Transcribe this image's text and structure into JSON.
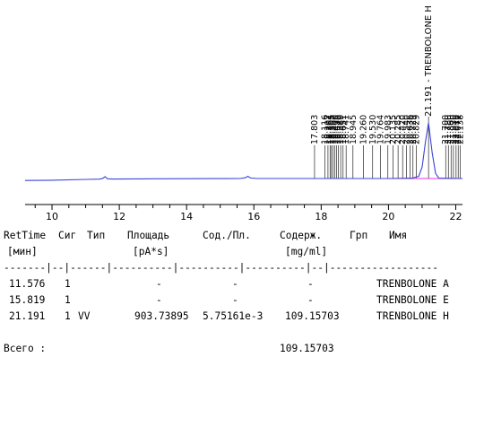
{
  "chart_data": {
    "type": "line",
    "xlabel": "",
    "ylabel": "",
    "xlim": [
      9.2,
      22.2
    ],
    "ylim": [
      0,
      100
    ],
    "x_ticks": [
      "10",
      "12",
      "14",
      "16",
      "18",
      "20",
      "22"
    ],
    "series": [
      {
        "x": [
          9.2,
          10.0,
          11.0,
          11.4,
          11.5,
          11.576,
          11.65,
          11.8,
          12.5,
          13.0,
          14.0,
          14.8,
          15.6,
          15.75,
          15.819,
          15.9,
          16.1,
          17.0,
          18.0,
          19.0,
          20.0,
          20.7,
          20.9,
          21.0,
          21.1,
          21.191,
          21.3,
          21.4,
          21.5,
          22.2
        ],
        "y": [
          0.5,
          0.8,
          1.6,
          1.9,
          2.5,
          4.5,
          2.3,
          2.0,
          2.2,
          2.3,
          2.4,
          2.5,
          2.6,
          3.5,
          5.0,
          3.2,
          2.6,
          2.6,
          2.6,
          2.6,
          2.6,
          3.0,
          5.0,
          15.0,
          42.0,
          62.0,
          30.0,
          8.0,
          3.0,
          2.6
        ],
        "color": "#3b44d8"
      }
    ],
    "baseline": {
      "x": [
        19.3,
        22.2
      ],
      "y": [
        2.6,
        2.6
      ],
      "color": "#e33ae0"
    },
    "peak_labels": [
      {
        "x": 17.803,
        "text": "17.803"
      },
      {
        "x": 18.116,
        "text": "18.116"
      },
      {
        "x": 18.202,
        "text": "18.202"
      },
      {
        "x": 18.264,
        "text": "18.264"
      },
      {
        "x": 18.305,
        "text": "18.305"
      },
      {
        "x": 18.352,
        "text": "18.352"
      },
      {
        "x": 18.4,
        "text": "18.400"
      },
      {
        "x": 18.455,
        "text": "18.455"
      },
      {
        "x": 18.51,
        "text": "18.510"
      },
      {
        "x": 18.58,
        "text": "18.580"
      },
      {
        "x": 18.651,
        "text": "18.651"
      },
      {
        "x": 18.741,
        "text": "18.741"
      },
      {
        "x": 18.945,
        "text": "18.945"
      },
      {
        "x": 19.26,
        "text": "19.260"
      },
      {
        "x": 19.53,
        "text": "19.530"
      },
      {
        "x": 19.764,
        "text": "19.764"
      },
      {
        "x": 19.983,
        "text": "19.983"
      },
      {
        "x": 20.135,
        "text": "20.135"
      },
      {
        "x": 20.285,
        "text": "20.285"
      },
      {
        "x": 20.42,
        "text": "20.420"
      },
      {
        "x": 20.54,
        "text": "20.540"
      },
      {
        "x": 20.636,
        "text": "20.636"
      },
      {
        "x": 20.729,
        "text": "20.729"
      },
      {
        "x": 20.829,
        "text": "20.829"
      },
      {
        "x": 21.191,
        "text": "21.191 - TRENBOLONE H"
      },
      {
        "x": 21.7,
        "text": "21.700"
      },
      {
        "x": 21.78,
        "text": "21.780"
      },
      {
        "x": 21.86,
        "text": "21.860"
      },
      {
        "x": 21.93,
        "text": "21.930"
      },
      {
        "x": 22.01,
        "text": "22.010"
      },
      {
        "x": 22.072,
        "text": "22.072"
      },
      {
        "x": 22.138,
        "text": "22.138"
      }
    ]
  },
  "report": {
    "header1": [
      "RetTime",
      "Сиг",
      "Тип",
      "Площадь",
      "Сод./Пл.",
      "Содерж.",
      "Грп",
      "Имя"
    ],
    "header2": [
      "[мин]",
      "[pA*s]",
      "[mg/ml]"
    ],
    "separator": "-------|--|------|----------|----------|----------|--|------------------",
    "rows": [
      {
        "ret": "11.576",
        "sig": "1",
        "type": "",
        "area": "-",
        "ratio": "-",
        "amount": "-",
        "grp": "",
        "name": "TRENBOLONE A"
      },
      {
        "ret": "15.819",
        "sig": "1",
        "type": "",
        "area": "-",
        "ratio": "-",
        "amount": "-",
        "grp": "",
        "name": "TRENBOLONE E"
      },
      {
        "ret": "21.191",
        "sig": "1",
        "type": "VV",
        "area": "903.73895",
        "ratio": "5.75161e-3",
        "amount": "109.15703",
        "grp": "",
        "name": "TRENBOLONE H"
      }
    ],
    "total_label": "Всего :",
    "total_value": "109.15703"
  }
}
